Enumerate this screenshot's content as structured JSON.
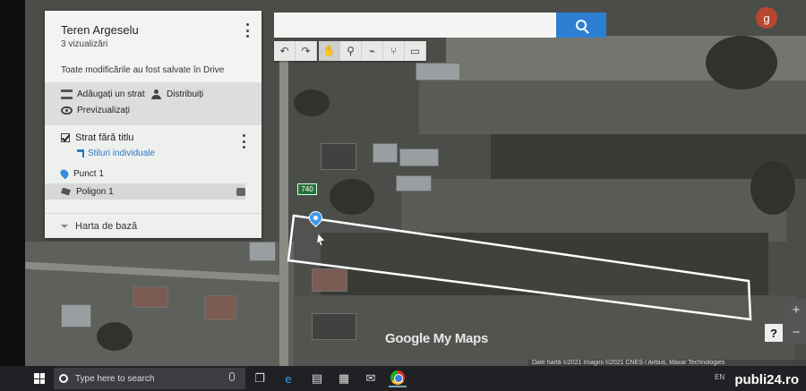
{
  "map": {
    "title": "Teren Argeselu",
    "views": "3 vizualizări",
    "saved_message": "Toate modificările au fost salvate în Drive",
    "actions": {
      "add_layer": "Adăugați un strat",
      "share": "Distribuiți",
      "preview": "Previzualizați"
    },
    "layer": {
      "name": "Strat fără titlu",
      "style_link": "Stiluri individuale",
      "features": [
        {
          "name": "Punct 1",
          "type": "point"
        },
        {
          "name": "Poligon 1",
          "type": "polygon",
          "selected": true
        }
      ]
    },
    "base_map": "Harta de bază",
    "road_label": "740",
    "logo": "Google My Maps",
    "attribution": "Date hartă ©2021 Imagini ©2021 CNES / Airbus, Maxar Technologies",
    "avatar_letter": "g"
  },
  "search": {
    "value": "",
    "placeholder": ""
  },
  "toolbar": {
    "tools": [
      {
        "name": "undo",
        "glyph": "↶"
      },
      {
        "name": "redo",
        "glyph": "↷"
      },
      {
        "name": "hand",
        "glyph": "✋",
        "active": true
      },
      {
        "name": "marker",
        "glyph": "⚲"
      },
      {
        "name": "draw-line",
        "glyph": "⌁"
      },
      {
        "name": "directions",
        "glyph": "⑂"
      },
      {
        "name": "measure",
        "glyph": "▭"
      }
    ]
  },
  "zoom": {
    "in": "+",
    "out": "−"
  },
  "help": "?",
  "taskbar": {
    "search_placeholder": "Type here to search",
    "tray": "EN"
  },
  "watermark": "publi24.ro"
}
